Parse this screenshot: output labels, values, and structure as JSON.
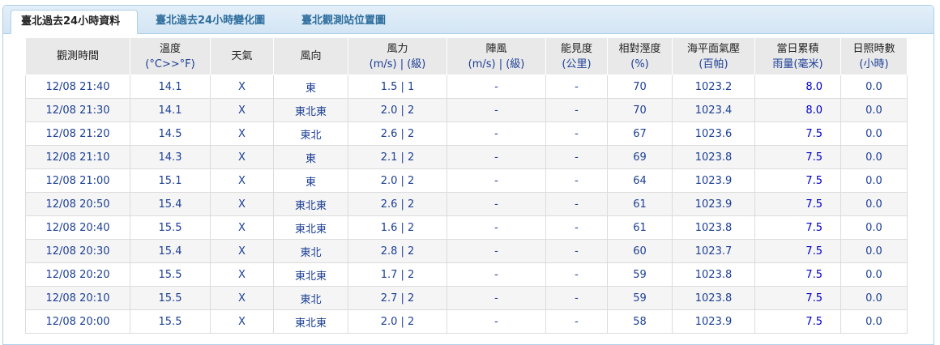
{
  "tabs": [
    {
      "label": "臺北過去24小時資料"
    },
    {
      "label": "臺北過去24小時變化圖"
    },
    {
      "label": "臺北觀測站位置圖"
    }
  ],
  "headers": [
    {
      "main": "觀測時間",
      "sub": ""
    },
    {
      "main": "溫度",
      "sub": "(°C>>°F)"
    },
    {
      "main": "天氣",
      "sub": ""
    },
    {
      "main": "風向",
      "sub": ""
    },
    {
      "main": "風力",
      "sub": "(m/s) | (級)"
    },
    {
      "main": "陣風",
      "sub": "(m/s) | (級)"
    },
    {
      "main": "能見度",
      "sub": "(公里)"
    },
    {
      "main": "相對溼度",
      "sub": "(%)"
    },
    {
      "main": "海平面氣壓",
      "sub": "(百帕)"
    },
    {
      "main": "當日累積",
      "sub": "雨量(毫米)"
    },
    {
      "main": "日照時數",
      "sub": "(小時)"
    }
  ],
  "rows": [
    [
      "12/08 21:40",
      "14.1",
      "X",
      "東",
      "1.5 | 1",
      "-",
      "-",
      "70",
      "1023.2",
      "8.0",
      "0.0"
    ],
    [
      "12/08 21:30",
      "14.1",
      "X",
      "東北東",
      "2.0 | 2",
      "-",
      "-",
      "70",
      "1023.4",
      "8.0",
      "0.0"
    ],
    [
      "12/08 21:20",
      "14.5",
      "X",
      "東北",
      "2.6 | 2",
      "-",
      "-",
      "67",
      "1023.6",
      "7.5",
      "0.0"
    ],
    [
      "12/08 21:10",
      "14.3",
      "X",
      "東",
      "2.1 | 2",
      "-",
      "-",
      "69",
      "1023.8",
      "7.5",
      "0.0"
    ],
    [
      "12/08 21:00",
      "15.1",
      "X",
      "東",
      "2.0 | 2",
      "-",
      "-",
      "64",
      "1023.9",
      "7.5",
      "0.0"
    ],
    [
      "12/08 20:50",
      "15.4",
      "X",
      "東北東",
      "2.6 | 2",
      "-",
      "-",
      "61",
      "1023.9",
      "7.5",
      "0.0"
    ],
    [
      "12/08 20:40",
      "15.5",
      "X",
      "東北東",
      "1.6 | 2",
      "-",
      "-",
      "61",
      "1023.8",
      "7.5",
      "0.0"
    ],
    [
      "12/08 20:30",
      "15.4",
      "X",
      "東北",
      "2.8 | 2",
      "-",
      "-",
      "60",
      "1023.7",
      "7.5",
      "0.0"
    ],
    [
      "12/08 20:20",
      "15.5",
      "X",
      "東北東",
      "1.7 | 2",
      "-",
      "-",
      "59",
      "1023.8",
      "7.5",
      "0.0"
    ],
    [
      "12/08 20:10",
      "15.5",
      "X",
      "東北",
      "2.7 | 2",
      "-",
      "-",
      "59",
      "1023.8",
      "7.5",
      "0.0"
    ],
    [
      "12/08 20:00",
      "15.5",
      "X",
      "東北東",
      "2.0 | 2",
      "-",
      "-",
      "58",
      "1023.9",
      "7.5",
      "0.0"
    ]
  ]
}
